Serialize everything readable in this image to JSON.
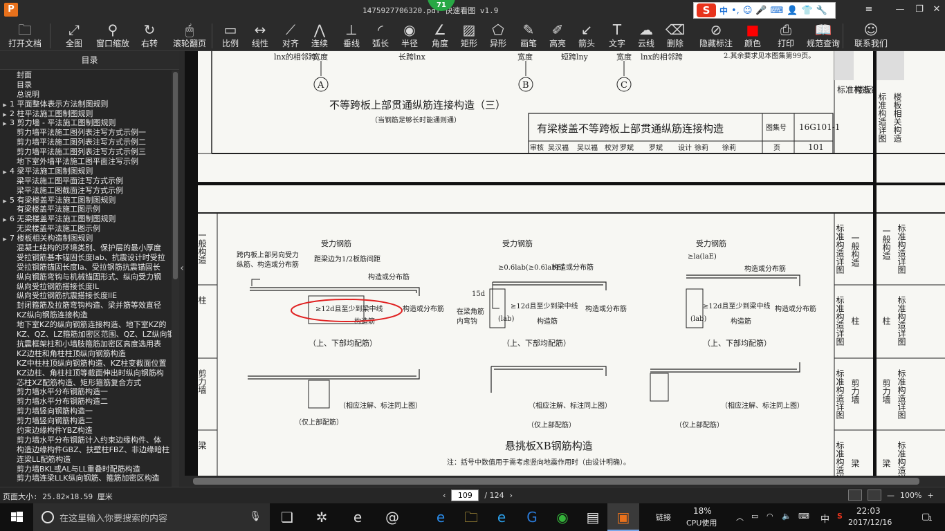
{
  "window": {
    "title": "1475927706320.pdf  快速看图 v1.9",
    "badge": "71",
    "logo_letter": "P"
  },
  "ime": {
    "lang": "中",
    "punct": "•,"
  },
  "toolbar": {
    "items": [
      {
        "label": "打开文档",
        "icon": "folder-icon",
        "glyph": "🗀"
      },
      {
        "label": "全图",
        "icon": "fullview-icon",
        "glyph": "⤢"
      },
      {
        "label": "窗口缩放",
        "icon": "magnifier-icon",
        "glyph": "⚲"
      },
      {
        "label": "右转",
        "icon": "rotate-right-icon",
        "glyph": "↻"
      },
      {
        "label": "滚轮翻页",
        "icon": "mouse-wheel-icon",
        "glyph": "🖱"
      },
      {
        "label": "比例",
        "icon": "ruler-icon",
        "glyph": "▭"
      },
      {
        "label": "线性",
        "icon": "linear-measure-icon",
        "glyph": "↔"
      },
      {
        "label": "对齐",
        "icon": "align-icon",
        "glyph": "⟋"
      },
      {
        "label": "连续",
        "icon": "continuous-icon",
        "glyph": "⋀"
      },
      {
        "label": "垂线",
        "icon": "perpendicular-icon",
        "glyph": "⊥"
      },
      {
        "label": "弧长",
        "icon": "arc-length-icon",
        "glyph": "◜"
      },
      {
        "label": "半径",
        "icon": "radius-icon",
        "glyph": "◉"
      },
      {
        "label": "角度",
        "icon": "angle-icon",
        "glyph": "∠"
      },
      {
        "label": "矩形",
        "icon": "rectangle-icon",
        "glyph": "▨"
      },
      {
        "label": "异形",
        "icon": "polygon-icon",
        "glyph": "⬠"
      },
      {
        "label": "画笔",
        "icon": "pen-icon",
        "glyph": "✎"
      },
      {
        "label": "高亮",
        "icon": "highlighter-icon",
        "glyph": "✐"
      },
      {
        "label": "箭头",
        "icon": "arrow-icon",
        "glyph": "↙"
      },
      {
        "label": "文字",
        "icon": "text-icon",
        "glyph": "T"
      },
      {
        "label": "云线",
        "icon": "cloud-line-icon",
        "glyph": "☁"
      },
      {
        "label": "删除",
        "icon": "eraser-icon",
        "glyph": "⌫"
      },
      {
        "label": "隐藏标注",
        "icon": "hide-markup-icon",
        "glyph": "⊘"
      },
      {
        "label": "颜色",
        "icon": "color-swatch-icon",
        "glyph": "■"
      },
      {
        "label": "打印",
        "icon": "printer-icon",
        "glyph": "⎙"
      },
      {
        "label": "规范查询",
        "icon": "book-search-icon",
        "glyph": "📖"
      },
      {
        "label": "联系我们",
        "icon": "contact-icon",
        "glyph": "☺"
      }
    ],
    "accent_color": "#ff0000"
  },
  "toc": {
    "title": "目录",
    "items": [
      {
        "text": "封面",
        "arrow": false
      },
      {
        "text": "目录",
        "arrow": false
      },
      {
        "text": "总说明",
        "arrow": false
      },
      {
        "text": "1 平面整体表示方法制图规则",
        "arrow": true
      },
      {
        "text": "2 柱平法施工图制图规则",
        "arrow": true
      },
      {
        "text": "3 剪力墙 - 平法施工图制图规则",
        "arrow": true
      },
      {
        "text": "剪力墙平法施工图列表注写方式示例一",
        "arrow": false
      },
      {
        "text": "剪力墙平法施工图列表注写方式示例二",
        "arrow": false
      },
      {
        "text": "剪力墙平法施工图列表注写方式示例三",
        "arrow": false
      },
      {
        "text": "地下室外墙平法施工图平面注写示例",
        "arrow": false
      },
      {
        "text": "4 梁平法施工图制图规则",
        "arrow": true
      },
      {
        "text": "梁平法施工图平面注写方式示例",
        "arrow": false
      },
      {
        "text": "梁平法施工图截面注写方式示例",
        "arrow": false
      },
      {
        "text": "5 有梁楼盖平法施工图制图规则",
        "arrow": true
      },
      {
        "text": "有梁楼盖平法施工图示例",
        "arrow": false
      },
      {
        "text": "6 无梁楼盖平法施工图制图规则",
        "arrow": true
      },
      {
        "text": "无梁楼盖平法施工图示例",
        "arrow": false
      },
      {
        "text": "7 楼板相关构造制图规则",
        "arrow": true
      },
      {
        "text": "混凝土结构的环境类别、保护层的最小厚度",
        "arrow": false
      },
      {
        "text": "受拉钢筋基本锚固长度lab、抗震设计时受拉",
        "arrow": false
      },
      {
        "text": "受拉钢筋锚固长度la、受拉钢筋抗震锚固长",
        "arrow": false
      },
      {
        "text": "纵向钢筋弯钩与机械锚固形式、纵向受力钢",
        "arrow": false
      },
      {
        "text": "纵向受拉钢筋搭接长度lL",
        "arrow": false
      },
      {
        "text": "纵向受拉钢筋抗震搭接长度llE",
        "arrow": false
      },
      {
        "text": "封闭箍筋及拉筋弯钩构造、梁并筋等效直径",
        "arrow": false
      },
      {
        "text": "KZ纵向钢筋连接构造",
        "arrow": false
      },
      {
        "text": "地下室KZ的纵向钢筋连接构造、地下室KZ的",
        "arrow": false
      },
      {
        "text": "KZ、QZ、LZ箍筋加密区范围、QZ、LZ纵向钢",
        "arrow": false
      },
      {
        "text": "抗震框架柱和小墙肢箍筋加密区高度选用表",
        "arrow": false
      },
      {
        "text": "KZ边柱和角柱柱顶纵向钢筋构造",
        "arrow": false
      },
      {
        "text": "KZ中柱柱顶纵向钢筋构造、KZ柱变截面位置",
        "arrow": false
      },
      {
        "text": "KZ边柱、角柱柱顶等截面伸出时纵向钢筋构",
        "arrow": false
      },
      {
        "text": "芯柱XZ配筋构造、矩形箍筋复合方式",
        "arrow": false
      },
      {
        "text": "剪力墙水平分布钢筋构造一",
        "arrow": false
      },
      {
        "text": "剪力墙水平分布钢筋构造二",
        "arrow": false
      },
      {
        "text": "剪力墙竖向钢筋构造一",
        "arrow": false
      },
      {
        "text": "剪力墙竖向钢筋构造二",
        "arrow": false
      },
      {
        "text": "约束边缘构件YBZ构造",
        "arrow": false
      },
      {
        "text": "剪力墙水平分布钢筋计入约束边缘构件、体",
        "arrow": false
      },
      {
        "text": "构造边缘构件GBZ、扶壁柱FBZ、非边缘暗柱",
        "arrow": false
      },
      {
        "text": "连梁LL配筋构造",
        "arrow": false
      },
      {
        "text": "剪力墙BKL或AL与LL重叠时配筋构造",
        "arrow": false
      },
      {
        "text": "剪力墙连梁LLK纵向钢筋、箍筋加密区构造",
        "arrow": false
      }
    ]
  },
  "drawing": {
    "top_page": {
      "span_labels": [
        "lnx的相邻跨",
        "宽度",
        "长跨lnx",
        "宽度",
        "短跨lny",
        "宽度",
        "lnx的相邻跨"
      ],
      "note_right": "2.其余要求见本图集第99页。",
      "axis_labels": [
        "A",
        "B",
        "C"
      ],
      "section_title": "不等跨板上部贯通纵筋连接构造（三）",
      "section_sub": "（当钢筋足够长时能通则通）",
      "title_block": {
        "title": "有梁楼盖不等跨板上部贯通纵筋连接构造",
        "atlas_label": "图集号",
        "atlas_no": "16G101-1",
        "review_row": [
          "审核",
          "吴汉福",
          "吴以福",
          "校对",
          "罗斌",
          "罗斌",
          "设计",
          "徐莉",
          "徐莉",
          "页"
        ],
        "page_no": "101"
      },
      "side_tabs": [
        "标准构造详图",
        "楼板相关构造"
      ]
    },
    "bottom_page": {
      "left_tabs": [
        "标准构造详图",
        "一般构造",
        "标准构造详图",
        "柱",
        "标准构造详图",
        "剪力墙",
        "标准构造详图",
        "梁"
      ],
      "detail1": {
        "top": "受力钢筋",
        "left1": "跨内板上部另向受力",
        "left2": "纵筋、构造或分布筋",
        "spacing": "距梁边为1/2板筋间距",
        "dist": "构造或分布筋",
        "anchor": "≥12d且至少到梁中线",
        "dist2": "构造或分布筋",
        "bottom": "构造筋",
        "caption": "（上、下部均配筋）"
      },
      "detail2": {
        "top": "受力钢筋",
        "anchor_top": "≥0.6lab(≥0.6labE)",
        "dist": "构造或分布筋",
        "dim": "15d",
        "anchor": "≥12d且至少到梁中线",
        "dist2": "构造或分布筋",
        "l1": "在梁角筋",
        "l2": "内弯钩",
        "la": "(lab)",
        "bottom": "构造筋",
        "caption": "（上、下部均配筋）"
      },
      "detail3": {
        "top": "受力钢筋",
        "anchor_top": "≥la(laE)",
        "dist": "构造或分布筋",
        "anchor": "≥12d且至少到梁中线",
        "dist2": "构造或分布筋",
        "la": "(lab)",
        "bottom": "构造筋",
        "caption": "（上、下部均配筋）"
      },
      "detail4": {
        "note": "（相应注解、标注同上图）",
        "caption": "（仅上部配筋）"
      },
      "detail5": {
        "note": "（相应注解、标注同上图）",
        "caption": "（仅上部配筋）"
      },
      "detail6": {
        "note": "（相应注解、标注同上图）",
        "caption": "（仅上部配筋）"
      },
      "main_title": "悬挑板XB钢筋构造",
      "footnote": "注：括号中数值用于需考虑竖向地震作用时（由设计明确）。",
      "right_tabs": [
        "标准构造详图",
        "一般构造",
        "标准构造详图",
        "柱",
        "标准构造详图",
        "剪力墙",
        "标准构造详图",
        "梁"
      ]
    },
    "highlight_color": "#e02020"
  },
  "status": {
    "page_size": "页面大小: 25.82×18.59 厘米",
    "current_page": "109",
    "total_pages": "/ 124",
    "zoom": "100%",
    "zoom_minus": "—",
    "zoom_plus": "+"
  },
  "taskbar": {
    "search_placeholder": "在这里输入你要搜索的内容",
    "tray_link": "链接",
    "cpu_percent": "18%",
    "cpu_label": "CPU使用",
    "ime": "中",
    "time": "22:03",
    "date": "2017/12/16",
    "notif_count": "1"
  }
}
